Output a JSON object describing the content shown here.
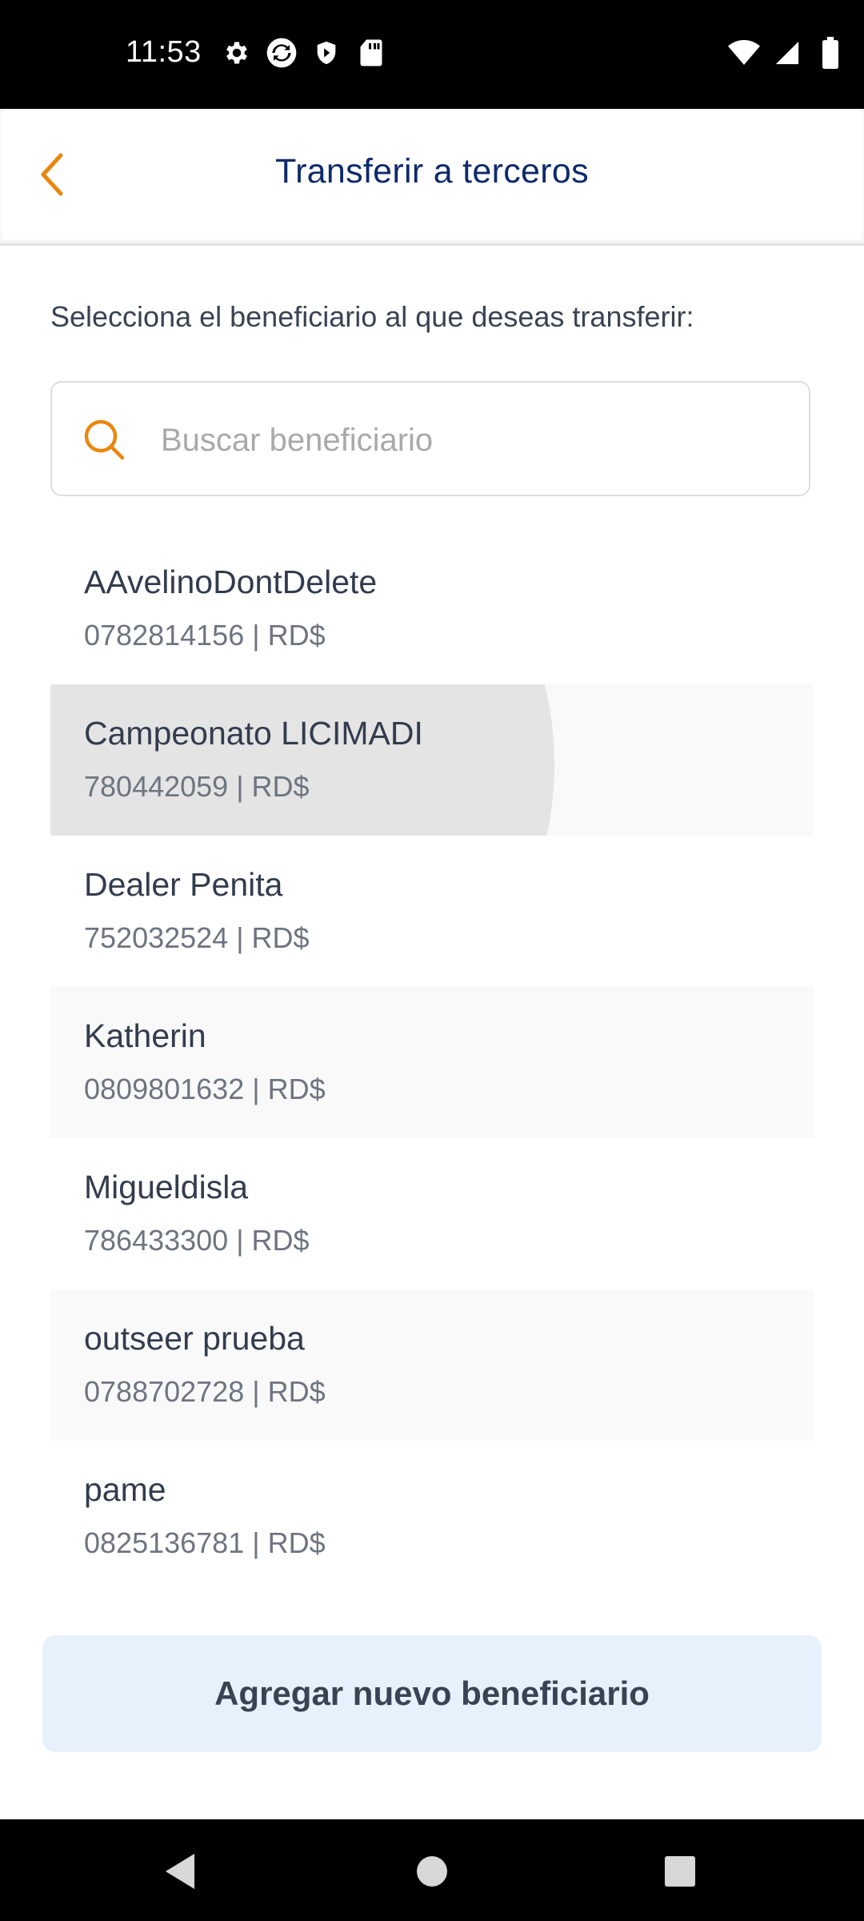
{
  "status_bar": {
    "time": "11:53",
    "left_icons": [
      "settings-icon",
      "sync-icon",
      "shield-icon",
      "sd-card-icon"
    ],
    "right_icons": [
      "wifi-icon",
      "signal-icon",
      "battery-icon"
    ]
  },
  "header": {
    "title": "Transferir a terceros",
    "back_icon": "chevron-left-icon",
    "accent_color": "#E8870E"
  },
  "instruction": "Selecciona el beneficiario al que deseas transferir:",
  "search": {
    "placeholder": "Buscar beneficiario",
    "value": ""
  },
  "beneficiaries": [
    {
      "name": "AAvelinoDontDelete",
      "detail": "0782814156 | RD$"
    },
    {
      "name": "Campeonato LICIMADI",
      "detail": "780442059 | RD$"
    },
    {
      "name": "Dealer Penita",
      "detail": "752032524 | RD$"
    },
    {
      "name": "Katherin",
      "detail": "0809801632 | RD$"
    },
    {
      "name": "Migueldisla",
      "detail": "786433300 | RD$"
    },
    {
      "name": "outseer prueba",
      "detail": "0788702728 | RD$"
    },
    {
      "name": "pame",
      "detail": "0825136781 | RD$"
    }
  ],
  "add_button_label": "Agregar nuevo beneficiario",
  "nav_bar": [
    "back-icon",
    "home-icon",
    "recents-icon"
  ]
}
